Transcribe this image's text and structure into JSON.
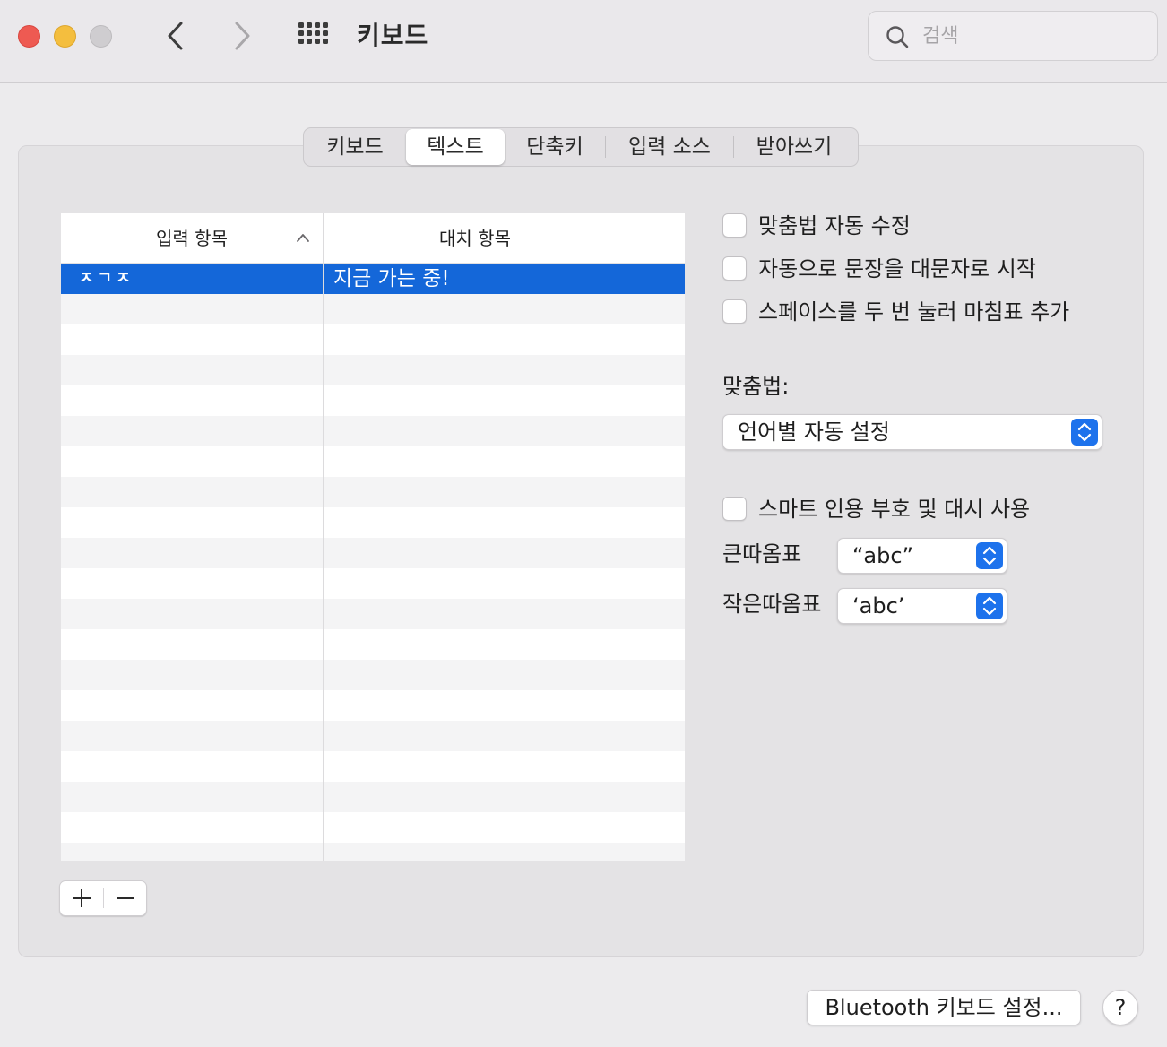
{
  "window": {
    "title": "키보드",
    "search_placeholder": "검색"
  },
  "icons": {
    "close": "close-icon",
    "minimize": "minimize-icon",
    "zoom": "zoom-icon",
    "back": "chevron-left-icon",
    "forward": "chevron-right-icon",
    "show_all": "grid-icon",
    "search": "search-icon",
    "sort": "chevron-up-icon",
    "add": "plus-icon",
    "remove": "minus-icon",
    "popup": "up-down-stepper-icon"
  },
  "colors": {
    "accent": "#1467d9",
    "stepper": "#1d72ec",
    "close": "#ee5a52",
    "minimize": "#f4be3e",
    "zoom_inactive": "#cfcdd0"
  },
  "tabs": [
    {
      "label": "키보드",
      "active": false
    },
    {
      "label": "텍스트",
      "active": true
    },
    {
      "label": "단축키",
      "active": false
    },
    {
      "label": "입력 소스",
      "active": false
    },
    {
      "label": "받아쓰기",
      "active": false
    }
  ],
  "table": {
    "columns": {
      "input": "입력 항목",
      "replace": "대치 항목"
    },
    "rows": [
      {
        "input": "ㅈㄱㅈ",
        "replace": "지금 가는 중!",
        "selected": true
      }
    ]
  },
  "options": {
    "autocorrect": {
      "label": "맞춤법 자동 수정",
      "checked": false
    },
    "capitalize": {
      "label": "자동으로 문장을 대문자로 시작",
      "checked": false
    },
    "period": {
      "label": "스페이스를 두 번 눌러 마침표 추가",
      "checked": false
    },
    "spelling_label": "맞춤법:",
    "spelling_value": "언어별 자동 설정",
    "smart_quotes": {
      "label": "스마트 인용 부호 및 대시 사용",
      "checked": false
    },
    "double_quotes_label": "큰따옴표",
    "double_quotes_value": "“abc”",
    "single_quotes_label": "작은따옴표",
    "single_quotes_value": "‘abc’"
  },
  "footer": {
    "bluetooth_button": "Bluetooth 키보드 설정...",
    "help_button": "?"
  }
}
